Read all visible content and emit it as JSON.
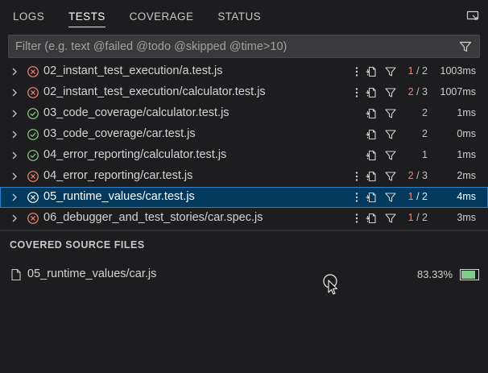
{
  "tabs": [
    {
      "label": "LOGS",
      "active": false
    },
    {
      "label": "TESTS",
      "active": true
    },
    {
      "label": "COVERAGE",
      "active": false
    },
    {
      "label": "STATUS",
      "active": false
    }
  ],
  "filter": {
    "placeholder": "Filter (e.g. text @failed @todo @skipped @time>10)"
  },
  "tests": [
    {
      "name": "02_instant_test_execution/a.test.js",
      "status": "failed",
      "failed": "1",
      "total": "2",
      "time": "1003ms",
      "has_menu": true,
      "selected": false
    },
    {
      "name": "02_instant_test_execution/calculator.test.js",
      "status": "failed",
      "failed": "2",
      "total": "3",
      "time": "1007ms",
      "has_menu": true,
      "selected": false
    },
    {
      "name": "03_code_coverage/calculator.test.js",
      "status": "passed",
      "failed": "",
      "total": "2",
      "time": "1ms",
      "has_menu": false,
      "selected": false
    },
    {
      "name": "03_code_coverage/car.test.js",
      "status": "passed",
      "failed": "",
      "total": "2",
      "time": "0ms",
      "has_menu": false,
      "selected": false
    },
    {
      "name": "04_error_reporting/calculator.test.js",
      "status": "passed",
      "failed": "",
      "total": "1",
      "time": "1ms",
      "has_menu": false,
      "selected": false
    },
    {
      "name": "04_error_reporting/car.test.js",
      "status": "failed",
      "failed": "2",
      "total": "3",
      "time": "2ms",
      "has_menu": true,
      "selected": false
    },
    {
      "name": "05_runtime_values/car.test.js",
      "status": "failed",
      "failed": "1",
      "total": "2",
      "time": "4ms",
      "has_menu": true,
      "selected": true
    },
    {
      "name": "06_debugger_and_test_stories/car.spec.js",
      "status": "failed",
      "failed": "1",
      "total": "2",
      "time": "3ms",
      "has_menu": true,
      "selected": false
    }
  ],
  "coverage_section": {
    "title": "COVERED SOURCE FILES",
    "files": [
      {
        "name": "05_runtime_values/car.js",
        "percent_label": "83.33%",
        "percent": 83.33
      }
    ]
  },
  "colors": {
    "failed": "#f48771",
    "passed": "#89d185",
    "selected_bg": "#04395e",
    "coverage_bar": "#7fce8a"
  },
  "icons": {
    "tabs_action": "open-in-window-icon",
    "filter": "filter-icon",
    "row_menu": "more-vertical-icon",
    "row_open": "go-to-file-icon",
    "row_filter": "filter-icon",
    "file": "file-icon"
  }
}
